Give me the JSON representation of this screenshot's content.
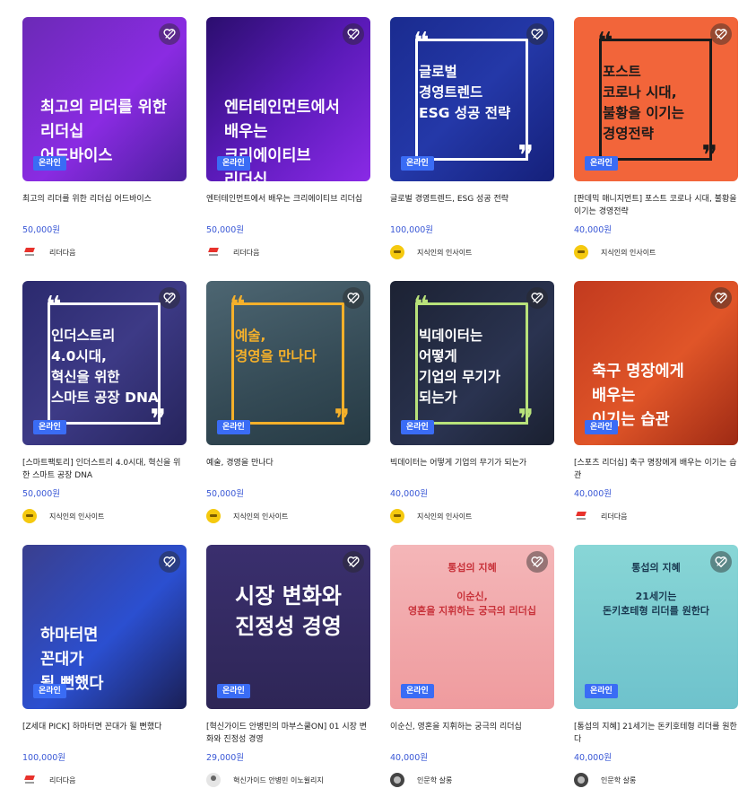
{
  "badge_label": "온라인",
  "cards": [
    {
      "thumb_text": "최고의 리더를 위한\n리더십\n어드바이스",
      "title": "최고의 리더를 위한 리더십 어드바이스",
      "price": "50,000원",
      "seller": "리더다음",
      "seller_type": "lead",
      "bg": "linear-gradient(135deg,#6b2ab6 0%,#8a2be2 55%,#4b1f9e 100%)",
      "style": "plain"
    },
    {
      "thumb_text": "엔터테인먼트에서\n배우는\n크리에이티브\n리더십",
      "title": "엔터테인먼트에서 배우는 크리에이티브 리더십",
      "price": "50,000원",
      "seller": "리더다음",
      "seller_type": "lead",
      "bg": "linear-gradient(135deg,#2b0e6e 0%,#5a1ab8 50%,#8a2ae6 100%)",
      "style": "plain"
    },
    {
      "thumb_text": "글로벌\n경영트렌드\nESG 성공 전략",
      "title": "글로벌 경영트렌드, ESG 성공 전략",
      "price": "100,000원",
      "seller": "지식인의 인사이트",
      "seller_type": "insight",
      "bg": "linear-gradient(135deg,#1a2b8f 0%,#2438a8 50%,#15207a 100%)",
      "style": "quote",
      "accent": "#ffffff"
    },
    {
      "thumb_text": "포스트\n코로나 시대,\n불황을 이기는\n경영전략",
      "title": "[판데믹 매니지먼트] 포스트 코로나 시대, 불황을 이기는 경영전략",
      "price": "40,000원",
      "seller": "지식인의 인사이트",
      "seller_type": "insight",
      "bg": "#f2653a",
      "style": "quote",
      "accent": "#1a1a1a",
      "text_color": "#1a1a1a"
    },
    {
      "thumb_text": "인더스트리\n4.0시대,\n혁신을 위한\n스마트 공장 DNA",
      "title": "[스마트팩토리] 인더스트리 4.0시대, 혁신을 위한 스마트 공장 DNA",
      "price": "50,000원",
      "seller": "지식인의 인사이트",
      "seller_type": "insight",
      "bg": "linear-gradient(135deg,#2b2a6e 0%,#3d3a86 50%,#26245c 100%)",
      "style": "quote",
      "accent": "#ffffff"
    },
    {
      "thumb_text": "예술,\n경영을 만나다",
      "title": "예술, 경영을 만나다",
      "price": "50,000원",
      "seller": "지식인의 인사이트",
      "seller_type": "insight",
      "bg": "linear-gradient(160deg,#4d6672 0%,#344a55 60%,#263a44 100%)",
      "style": "quote",
      "accent": "#f5b02a",
      "text_color": "#f5b02a"
    },
    {
      "thumb_text": "빅데이터는\n어떻게\n기업의 무기가\n되는가",
      "title": "빅데이터는 어떻게 기업의 무기가 되는가",
      "price": "40,000원",
      "seller": "지식인의 인사이트",
      "seller_type": "insight",
      "bg": "linear-gradient(135deg,#1c2233 0%,#2a3350 60%,#1a2030 100%)",
      "style": "quote",
      "accent": "#b8e27a"
    },
    {
      "thumb_text": "축구 명장에게\n배우는\n이기는 습관",
      "title": "[스포츠 리더십] 축구 명장에게 배우는 이기는 습관",
      "price": "40,000원",
      "seller": "리더다음",
      "seller_type": "lead",
      "bg": "linear-gradient(135deg,#c23a1f 0%,#e05528 55%,#9e2a14 100%)",
      "style": "plain"
    },
    {
      "thumb_text": "하마터면\n꼰대가\n될 뻔했다",
      "title": "[Z세대 PICK] 하마터면 꼰대가 될 뻔했다",
      "price": "100,000원",
      "seller": "리더다음",
      "seller_type": "lead",
      "bg": "linear-gradient(135deg,#3a3f8e 0%,#2b4fd0 55%,#1a1f55 100%)",
      "style": "plain"
    },
    {
      "thumb_text": "시장 변화와\n진정성 경영",
      "title": "[혁신가이드 안병민의 마부스쿨ON] 01 시장 변화와 진정성 경영",
      "price": "29,000원",
      "seller": "혁신가이드 안병민 이노윌리지",
      "seller_type": "guide",
      "bg": "linear-gradient(180deg,#3a2f6e 0%,#2e2656 100%)",
      "style": "big"
    },
    {
      "thumb_text": "통섭의 지혜\n\n이순신,\n영혼을 지휘하는 궁극의 리더십",
      "title": "이순신, 영혼을 지휘하는 궁극의 리더십",
      "price": "40,000원",
      "seller": "인문학 살롱",
      "seller_type": "human",
      "bg": "linear-gradient(180deg,#f4b6b8 0%,#ef9b9e 100%)",
      "style": "small",
      "text_color": "#c8323a"
    },
    {
      "thumb_text": "통섭의 지혜\n\n21세기는\n돈키호테형 리더를 원한다",
      "title": "[통섭의 지혜] 21세기는 돈키호테형 리더를 원한다",
      "price": "40,000원",
      "seller": "인문학 살롱",
      "seller_type": "human",
      "bg": "linear-gradient(180deg,#88d6d6 0%,#6ec2cc 100%)",
      "style": "small",
      "text_color": "#1a3a52"
    }
  ]
}
